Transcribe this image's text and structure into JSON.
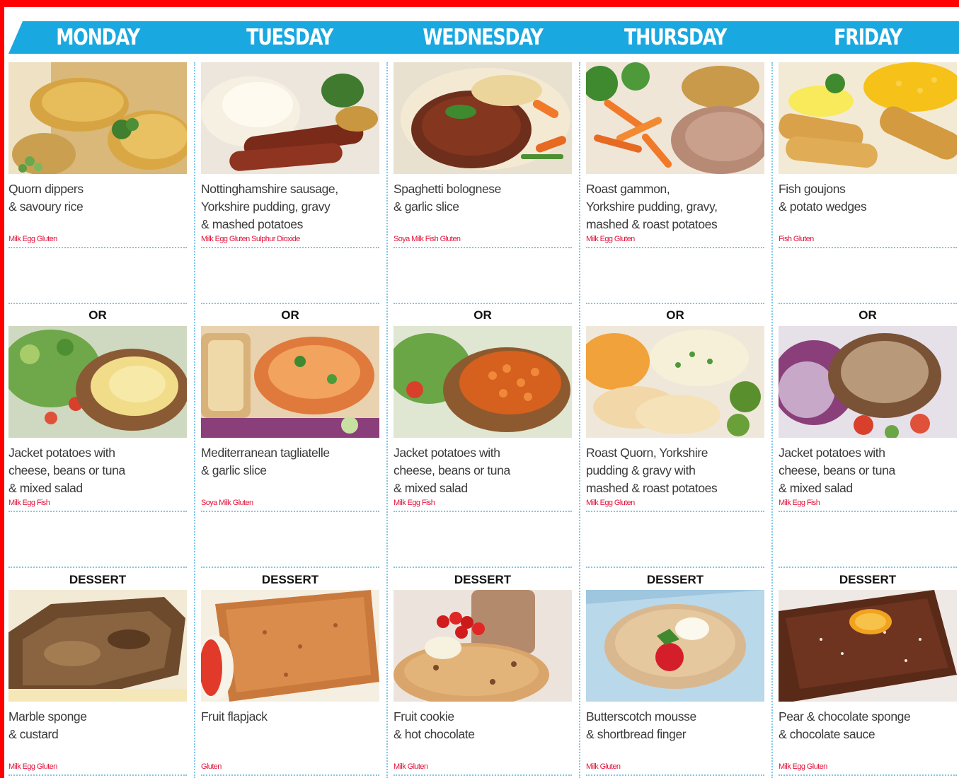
{
  "days": [
    {
      "name": "MONDAY",
      "main": {
        "lines": [
          "Quorn dippers",
          "& savoury rice"
        ],
        "allergens": "Milk Egg Gluten",
        "photo": "quorn-dippers-photo"
      },
      "alt": {
        "separator": "OR",
        "lines": [
          "Jacket potatoes with",
          "cheese, beans or tuna",
          "& mixed salad"
        ],
        "allergens": "Milk Egg Fish",
        "photo": "jacket-potato-photo"
      },
      "dessert": {
        "separator": "DESSERT",
        "lines": [
          "Marble sponge",
          "& custard"
        ],
        "allergens": "Milk Egg Gluten",
        "photo": "marble-sponge-photo"
      }
    },
    {
      "name": "TUESDAY",
      "main": {
        "lines": [
          "Nottinghamshire sausage,",
          "Yorkshire pudding, gravy",
          "& mashed potatoes"
        ],
        "allergens": "Milk Egg Gluten Sulphur Dioxide",
        "photo": "sausage-photo"
      },
      "alt": {
        "separator": "OR",
        "lines": [
          "Mediterranean tagliatelle",
          "& garlic slice"
        ],
        "allergens": "Soya Milk Gluten",
        "photo": "tagliatelle-photo"
      },
      "dessert": {
        "separator": "DESSERT",
        "lines": [
          "Fruit flapjack"
        ],
        "allergens": "Gluten",
        "photo": "flapjack-photo"
      }
    },
    {
      "name": "WEDNESDAY",
      "main": {
        "lines": [
          "Spaghetti bolognese",
          "& garlic slice"
        ],
        "allergens": "Soya Milk Fish Gluten",
        "photo": "bolognese-photo"
      },
      "alt": {
        "separator": "OR",
        "lines": [
          "Jacket potatoes with",
          "cheese, beans or tuna",
          "& mixed salad"
        ],
        "allergens": "Milk Egg Fish",
        "photo": "jacket-potato-beans-photo"
      },
      "dessert": {
        "separator": "DESSERT",
        "lines": [
          "Fruit cookie",
          "& hot chocolate"
        ],
        "allergens": "Milk Gluten",
        "photo": "fruit-cookie-photo"
      }
    },
    {
      "name": "THURSDAY",
      "main": {
        "lines": [
          "Roast gammon,",
          "Yorkshire pudding, gravy,",
          "mashed & roast potatoes"
        ],
        "allergens": "Milk Egg Gluten",
        "photo": "roast-gammon-photo"
      },
      "alt": {
        "separator": "OR",
        "lines": [
          "Roast Quorn, Yorkshire",
          "pudding & gravy with",
          "mashed & roast potatoes"
        ],
        "allergens": "Milk Egg Gluten",
        "photo": "roast-quorn-photo"
      },
      "dessert": {
        "separator": "DESSERT",
        "lines": [
          "Butterscotch mousse",
          "& shortbread finger"
        ],
        "allergens": "Milk Gluten",
        "photo": "butterscotch-mousse-photo"
      }
    },
    {
      "name": "FRIDAY",
      "main": {
        "lines": [
          "Fish goujons",
          "& potato wedges"
        ],
        "allergens": "Fish Gluten",
        "photo": "fish-goujons-photo"
      },
      "alt": {
        "separator": "OR",
        "lines": [
          "Jacket potatoes with",
          "cheese, beans or tuna",
          "& mixed salad"
        ],
        "allergens": "Milk Egg Fish",
        "photo": "jacket-potato-tuna-photo"
      },
      "dessert": {
        "separator": "DESSERT",
        "lines": [
          "Pear & chocolate sponge",
          "& chocolate sauce"
        ],
        "allergens": "Milk Egg Gluten",
        "photo": "chocolate-sponge-photo"
      }
    }
  ],
  "colors": {
    "banner": "#1aa8e0",
    "allergen": "#e0143c",
    "frame": "#ff0000",
    "dotted_rule": "#7fc7e8"
  }
}
